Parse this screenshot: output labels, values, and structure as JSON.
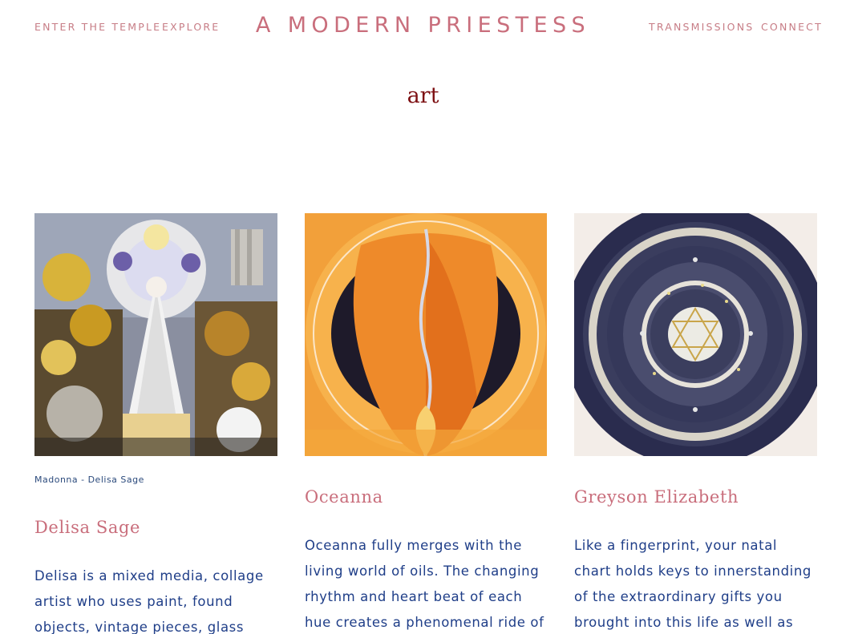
{
  "header": {
    "nav_left": [
      "ENTER THE TEMPLE",
      "EXPLORE"
    ],
    "site_title": "A MODERN PRIESTESS",
    "nav_right": [
      "TRANSMISSIONS",
      "CONNECT"
    ]
  },
  "page": {
    "heading": "art"
  },
  "colors": {
    "nav": "#c77d86",
    "title": "#c96e7c",
    "heading": "#7d0f12",
    "body_text": "#1f3e88",
    "caption": "#2b4a7c"
  },
  "cards": [
    {
      "image_subject": "collage-madonna-artwork",
      "caption": "Madonna - Delisa Sage",
      "name": "Delisa Sage",
      "description": "Delisa is a mixed media, collage artist who uses paint, found objects, vintage pieces, glass"
    },
    {
      "image_subject": "oil-painting-figure-artwork",
      "caption": "",
      "name": "Oceanna",
      "description": "Oceanna fully merges with the living world of oils. The changing rhythm and heart beat of each hue creates a phenomenal ride of"
    },
    {
      "image_subject": "natal-chart-mandala-artwork",
      "caption": "",
      "name": "Greyson Elizabeth",
      "description": "Like a fingerprint, your natal chart holds keys to innerstanding of the extraordinary gifts you brought into this life as well as"
    }
  ]
}
